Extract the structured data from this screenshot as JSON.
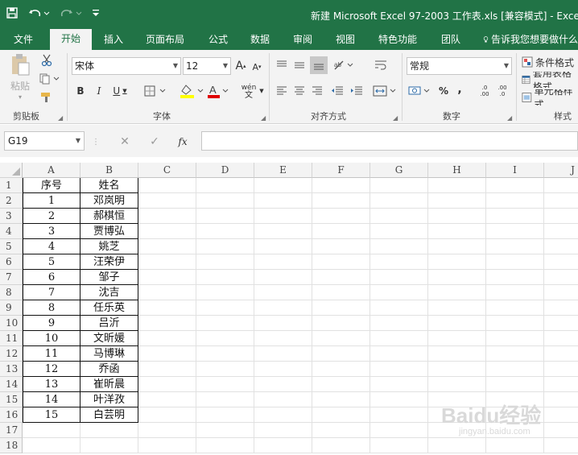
{
  "window": {
    "title": "新建 Microsoft Excel 97-2003 工作表.xls [兼容模式] - Excel"
  },
  "tabs": [
    "文件",
    "开始",
    "插入",
    "页面布局",
    "公式",
    "数据",
    "审阅",
    "视图",
    "特色功能",
    "团队"
  ],
  "active_tab": "开始",
  "tell_me": "告诉我您想要做什么",
  "ribbon": {
    "clipboard": {
      "label": "剪贴板",
      "paste": "粘贴"
    },
    "font": {
      "label": "字体",
      "name": "宋体",
      "size": "12",
      "phonetic": "wén"
    },
    "alignment": {
      "label": "对齐方式"
    },
    "number": {
      "label": "数字",
      "format": "常规"
    },
    "styles": {
      "label": "样式",
      "items": [
        "条件格式",
        "套用表格格式",
        "单元格样式"
      ]
    }
  },
  "formula_bar": {
    "name_box": "G19",
    "fx": "fx",
    "value": ""
  },
  "columns": [
    "A",
    "B",
    "C",
    "D",
    "E",
    "F",
    "G",
    "H",
    "I",
    "J"
  ],
  "rows": [
    "1",
    "2",
    "3",
    "4",
    "5",
    "6",
    "7",
    "8",
    "9",
    "10",
    "11",
    "12",
    "13",
    "14",
    "15",
    "16",
    "17",
    "18"
  ],
  "table": {
    "headers": [
      "序号",
      "姓名"
    ],
    "data": [
      [
        "1",
        "邓岚明"
      ],
      [
        "2",
        "郝棋恒"
      ],
      [
        "3",
        "贾博弘"
      ],
      [
        "4",
        "姚芝"
      ],
      [
        "5",
        "汪荣伊"
      ],
      [
        "6",
        "邹子"
      ],
      [
        "7",
        "沈吉"
      ],
      [
        "8",
        "任乐英"
      ],
      [
        "9",
        "吕沂"
      ],
      [
        "10",
        "文昕媛"
      ],
      [
        "11",
        "马博琳"
      ],
      [
        "12",
        "乔函"
      ],
      [
        "13",
        "崔昕晨"
      ],
      [
        "14",
        "叶洋孜"
      ],
      [
        "15",
        "白芸明"
      ]
    ]
  },
  "watermark": {
    "logo": "Baidu经验",
    "url": "jingyan.baidu.com"
  },
  "colors": {
    "brand": "#217346",
    "ribbon_bg": "#f3f3f3",
    "grid_line": "#e1e1e1"
  }
}
